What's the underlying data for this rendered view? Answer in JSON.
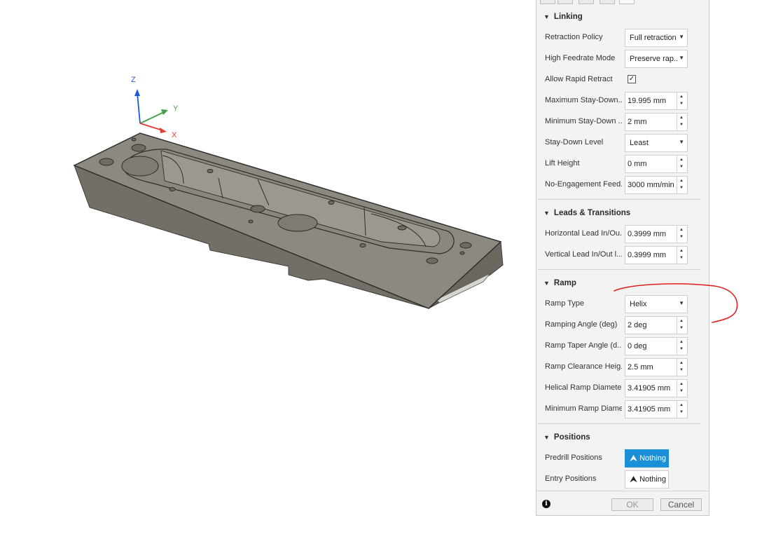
{
  "viewport": {
    "axes": {
      "z_label": "Z",
      "y_label": "Y",
      "x_label": "X"
    },
    "colors": {
      "x_axis": "#e53935",
      "y_axis": "#43a047",
      "z_axis": "#1e5bd6",
      "part_top": "#8c8980",
      "part_side": "#6d6a62"
    }
  },
  "panel": {
    "sections": {
      "linking": {
        "title": "Linking",
        "retraction_policy": {
          "label": "Retraction Policy",
          "value": "Full retraction"
        },
        "high_feedrate_mode": {
          "label": "High Feedrate Mode",
          "value": "Preserve rap..."
        },
        "allow_rapid_retract": {
          "label": "Allow Rapid Retract",
          "checked": "✓"
        },
        "maximum_stay_down": {
          "label": "Maximum Stay-Down...",
          "value": "19.995 mm"
        },
        "minimum_stay_down": {
          "label": "Minimum Stay-Down ...",
          "value": "2 mm"
        },
        "stay_down_level": {
          "label": "Stay-Down Level",
          "value": "Least"
        },
        "lift_height": {
          "label": "Lift Height",
          "value": "0 mm"
        },
        "no_engagement_feed": {
          "label": "No-Engagement Feed...",
          "value": "3000 mm/min"
        }
      },
      "leads": {
        "title": "Leads & Transitions",
        "horizontal_lead": {
          "label": "Horizontal Lead In/Ou...",
          "value": "0.3999 mm"
        },
        "vertical_lead": {
          "label": "Vertical Lead In/Out l...",
          "value": "0.3999 mm"
        }
      },
      "ramp": {
        "title": "Ramp",
        "ramp_type": {
          "label": "Ramp Type",
          "value": "Helix"
        },
        "ramping_angle": {
          "label": "Ramping Angle (deg)",
          "value": "2 deg"
        },
        "ramp_taper_angle": {
          "label": "Ramp Taper Angle (d...",
          "value": "0 deg"
        },
        "ramp_clearance_height": {
          "label": "Ramp Clearance Heig...",
          "value": "2.5 mm"
        },
        "helical_ramp_diameter": {
          "label": "Helical Ramp Diameter",
          "value": "3.41905 mm"
        },
        "minimum_ramp_diameter": {
          "label": "Minimum Ramp Diame...",
          "value": "3.41905 mm"
        }
      },
      "positions": {
        "title": "Positions",
        "predrill": {
          "label": "Predrill Positions",
          "value": "Nothing"
        },
        "entry": {
          "label": "Entry Positions",
          "value": "Nothing"
        }
      }
    },
    "footer": {
      "info": "i",
      "ok_label": "OK",
      "cancel_label": "Cancel"
    },
    "accent_color": "#1c8fd9"
  },
  "annotation": {
    "color": "#e02020"
  }
}
